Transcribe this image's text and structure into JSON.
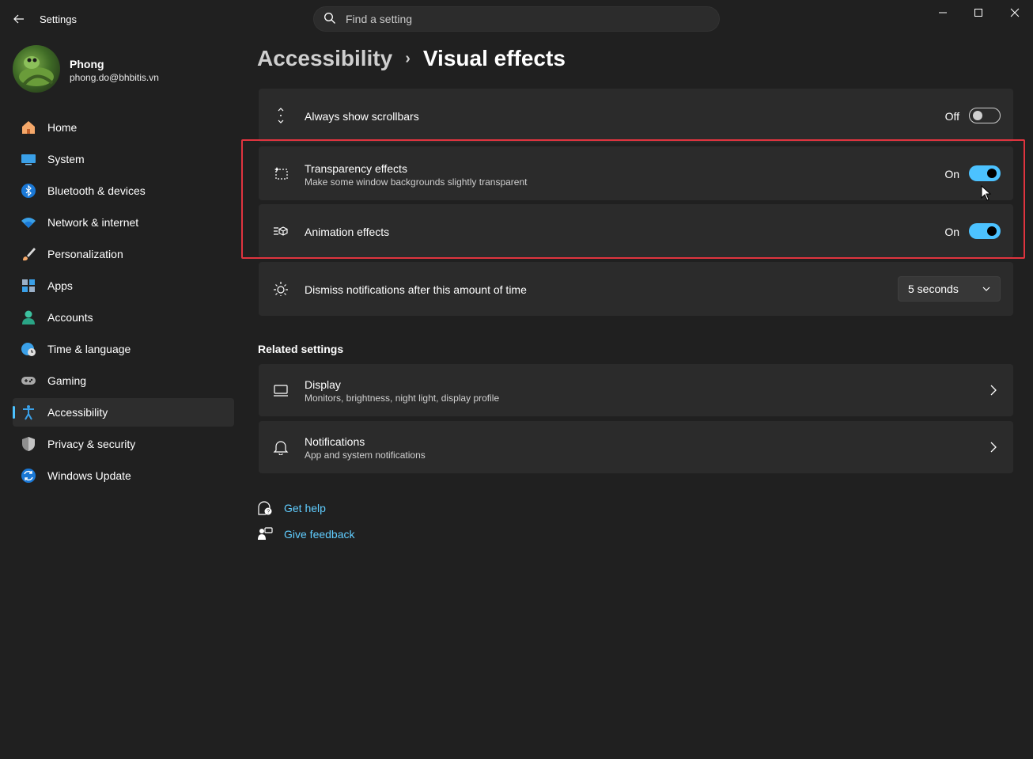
{
  "window": {
    "title": "Settings",
    "search_placeholder": "Find a setting"
  },
  "profile": {
    "name": "Phong",
    "email": "phong.do@bhbitis.vn"
  },
  "sidebar": {
    "items": [
      {
        "label": "Home",
        "icon": "home-icon"
      },
      {
        "label": "System",
        "icon": "system-icon"
      },
      {
        "label": "Bluetooth & devices",
        "icon": "bluetooth-icon"
      },
      {
        "label": "Network & internet",
        "icon": "wifi-icon"
      },
      {
        "label": "Personalization",
        "icon": "brush-icon"
      },
      {
        "label": "Apps",
        "icon": "apps-icon"
      },
      {
        "label": "Accounts",
        "icon": "account-icon"
      },
      {
        "label": "Time & language",
        "icon": "globe-clock-icon"
      },
      {
        "label": "Gaming",
        "icon": "gamepad-icon"
      },
      {
        "label": "Accessibility",
        "icon": "accessibility-icon",
        "active": true
      },
      {
        "label": "Privacy & security",
        "icon": "shield-icon"
      },
      {
        "label": "Windows Update",
        "icon": "update-icon"
      }
    ]
  },
  "breadcrumb": {
    "parent": "Accessibility",
    "separator": "›",
    "current": "Visual effects"
  },
  "settings": {
    "scrollbars": {
      "title": "Always show scrollbars",
      "state": "Off"
    },
    "transparency": {
      "title": "Transparency effects",
      "subtitle": "Make some window backgrounds slightly transparent",
      "state": "On"
    },
    "animation": {
      "title": "Animation effects",
      "state": "On"
    },
    "notifications_dismiss": {
      "title": "Dismiss notifications after this amount of time",
      "value": "5 seconds"
    }
  },
  "related": {
    "heading": "Related settings",
    "display": {
      "title": "Display",
      "subtitle": "Monitors, brightness, night light, display profile"
    },
    "notifications": {
      "title": "Notifications",
      "subtitle": "App and system notifications"
    }
  },
  "links": {
    "help": "Get help",
    "feedback": "Give feedback"
  },
  "colors": {
    "accent": "#4cc2ff",
    "link": "#60cdff",
    "highlight_box": "#e0343f",
    "background": "#202020",
    "card": "#2b2b2b"
  }
}
